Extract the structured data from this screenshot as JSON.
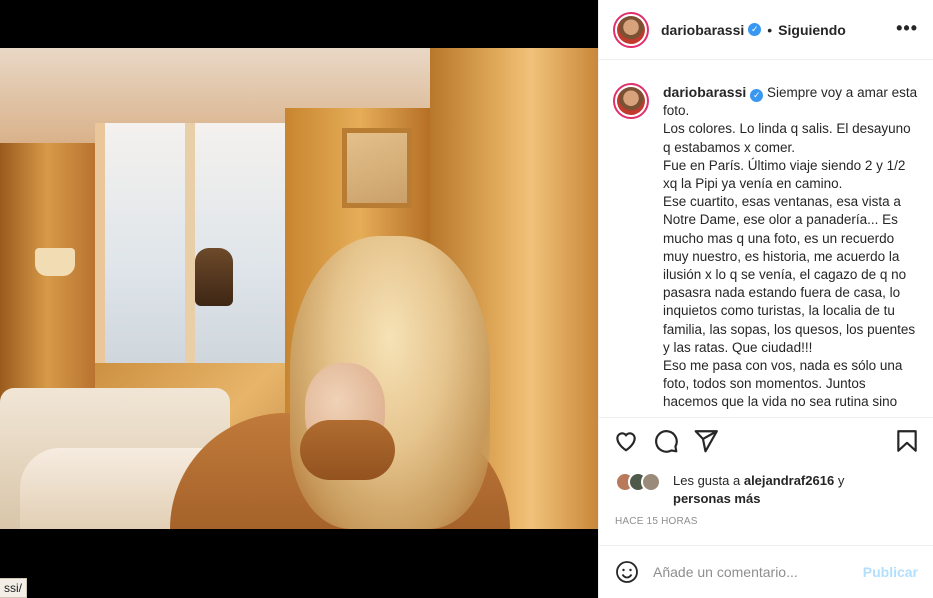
{
  "post": {
    "username": "dariobarassi",
    "follow_status": "Siguiendo",
    "more_label": "•••",
    "caption_lines": [
      "Siempre voy a amar esta",
      "foto.",
      "Los colores. Lo linda q salis. El desayuno",
      "q estabamos x comer.",
      "Fue en París. Último viaje siendo 2 y 1/2",
      "xq la Pipi ya venía en camino.",
      "Ese cuartito, esas ventanas, esa vista a",
      "Notre Dame, ese olor a panadería... Es",
      "mucho mas q una foto, es un recuerdo",
      "muy nuestro, es historia, me acuerdo la",
      "ilusión x lo q se venía, el cagazo de q no",
      "pasasra nada estando fuera de casa, lo",
      "inquietos como turistas, la localia de tu",
      "familia, las sopas, los quesos, los puentes",
      "y las ratas. Que ciudad!!!",
      "Eso me pasa con vos, nada es sólo una",
      "foto, todos son momentos. Juntos",
      "hacemos que la vida no sea rutina sino"
    ],
    "likes_prefix": "Les gusta a",
    "likes_user": "alejandraf2616",
    "likes_mid": "y",
    "likes_suffix": "personas más",
    "timestamp": "HACE 15 HORAS",
    "comment_placeholder": "Añade un comentario...",
    "publish_label": "Publicar"
  },
  "url_chip": "ssi/",
  "icons": [
    "heart-icon",
    "comment-icon",
    "share-icon",
    "bookmark-icon",
    "emoji-icon",
    "verified-icon"
  ],
  "colors": {
    "verified": "#3897f0",
    "avatar_ring": "#e1306c",
    "publish_disabled": "#b2dffc",
    "muted": "#8e8e8e"
  }
}
